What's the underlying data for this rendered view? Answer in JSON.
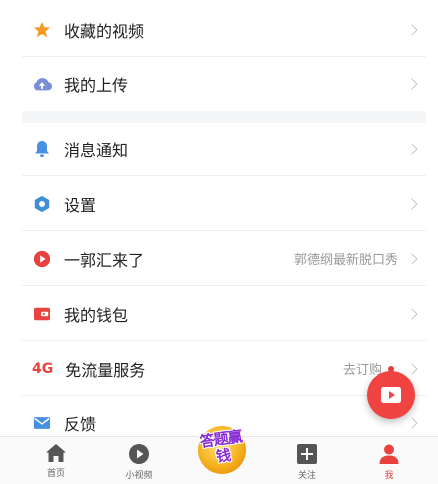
{
  "menu": {
    "favorites": {
      "label": "收藏的视频",
      "icon": "star-icon"
    },
    "uploads": {
      "label": "我的上传",
      "icon": "cloud-upload-icon"
    },
    "notifications": {
      "label": "消息通知",
      "icon": "bell-icon"
    },
    "settings": {
      "label": "设置",
      "icon": "hexagon-icon"
    },
    "yiguo": {
      "label": "一郭汇来了",
      "right": "郭德纲最新脱口秀",
      "icon": "play-circle-icon"
    },
    "wallet": {
      "label": "我的钱包",
      "icon": "wallet-icon"
    },
    "freedata": {
      "badge": "4G",
      "label": "免流量服务",
      "right": "去订购",
      "icon": "4g-icon"
    },
    "feedback": {
      "label": "反馈",
      "icon": "mail-icon"
    }
  },
  "tabbar": {
    "home": "首页",
    "shortvideo": "小视频",
    "promo": "答题赢钱",
    "follow": "关注",
    "me": "我"
  },
  "colors": {
    "accent": "#e8413e",
    "star": "#f59a23",
    "upload": "#7b8ed8",
    "bell": "#4a90e2",
    "settings": "#3f8ed6",
    "mail": "#4a90e2"
  }
}
